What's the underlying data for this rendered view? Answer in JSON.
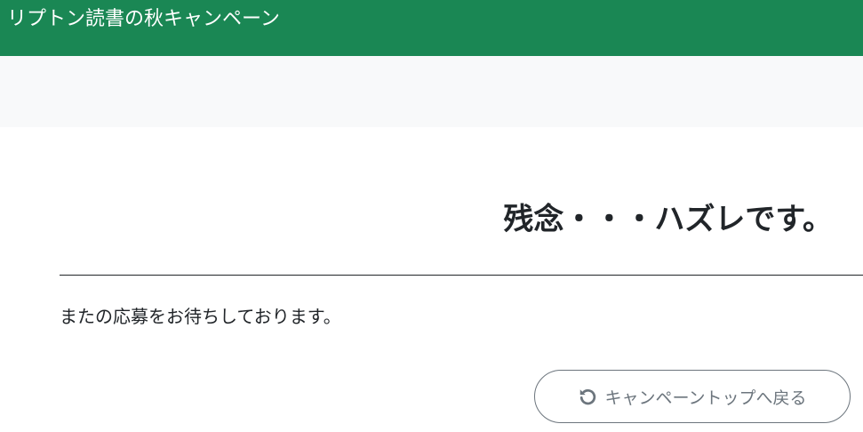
{
  "header": {
    "title": "リプトン読書の秋キャンペーン",
    "bg_color": "#1a8754",
    "text_color": "#ffffff"
  },
  "subheader": {
    "bg_color": "#f8f9fa"
  },
  "result": {
    "heading": "残念・・・ハズレです。",
    "message": "またの応募をお待ちしております。"
  },
  "back_button": {
    "label": "キャンペーントップへ戻る",
    "icon": "undo-arrow-icon",
    "color": "#6c757d"
  }
}
